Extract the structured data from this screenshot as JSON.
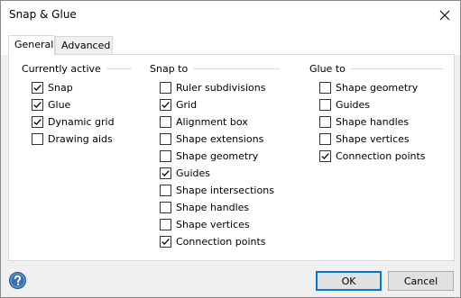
{
  "window": {
    "title": "Snap & Glue"
  },
  "tabs": [
    {
      "label": "General",
      "active": true
    },
    {
      "label": "Advanced",
      "active": false
    }
  ],
  "groups": {
    "currently_active": {
      "title": "Currently active",
      "items": [
        {
          "label": "Snap",
          "checked": true
        },
        {
          "label": "Glue",
          "checked": true
        },
        {
          "label": "Dynamic grid",
          "checked": true
        },
        {
          "label": "Drawing aids",
          "checked": false
        }
      ]
    },
    "snap_to": {
      "title": "Snap to",
      "items": [
        {
          "label": "Ruler subdivisions",
          "checked": false
        },
        {
          "label": "Grid",
          "checked": true
        },
        {
          "label": "Alignment box",
          "checked": false
        },
        {
          "label": "Shape extensions",
          "checked": false
        },
        {
          "label": "Shape geometry",
          "checked": false
        },
        {
          "label": "Guides",
          "checked": true
        },
        {
          "label": "Shape intersections",
          "checked": false
        },
        {
          "label": "Shape handles",
          "checked": false
        },
        {
          "label": "Shape vertices",
          "checked": false
        },
        {
          "label": "Connection points",
          "checked": true
        }
      ]
    },
    "glue_to": {
      "title": "Glue to",
      "items": [
        {
          "label": "Shape geometry",
          "checked": false
        },
        {
          "label": "Guides",
          "checked": false
        },
        {
          "label": "Shape handles",
          "checked": false
        },
        {
          "label": "Shape vertices",
          "checked": false
        },
        {
          "label": "Connection points",
          "checked": true
        }
      ]
    }
  },
  "footer": {
    "ok_label": "OK",
    "cancel_label": "Cancel"
  }
}
